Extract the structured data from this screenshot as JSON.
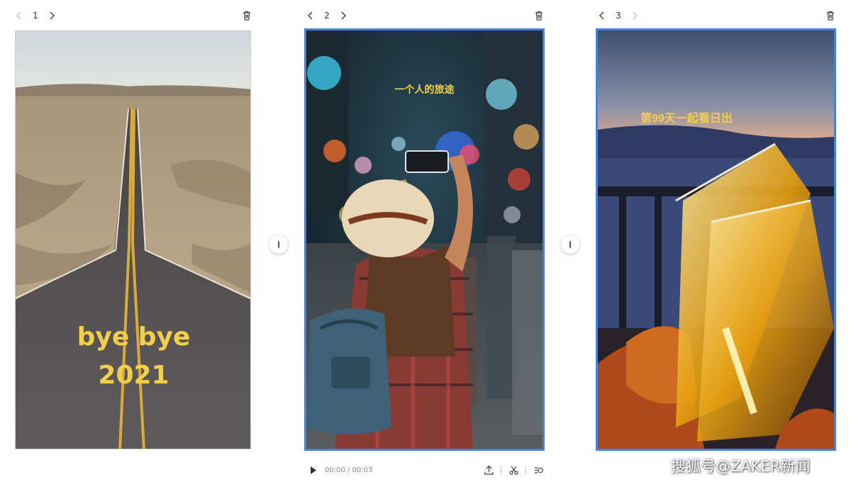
{
  "slides": [
    {
      "number": "1",
      "caption": "bye bye 2021",
      "caption_line1": "bye bye",
      "caption_line2": "2021"
    },
    {
      "number": "2",
      "caption": "一个人的旅途"
    },
    {
      "number": "3",
      "caption": "第99天一起看日出"
    }
  ],
  "player": {
    "time": "00:00 / 00:03"
  },
  "watermark": "搜狐号@ZAKER新闻",
  "colors": {
    "selection": "#4a7fe0",
    "caption": "#f2cf4a"
  }
}
